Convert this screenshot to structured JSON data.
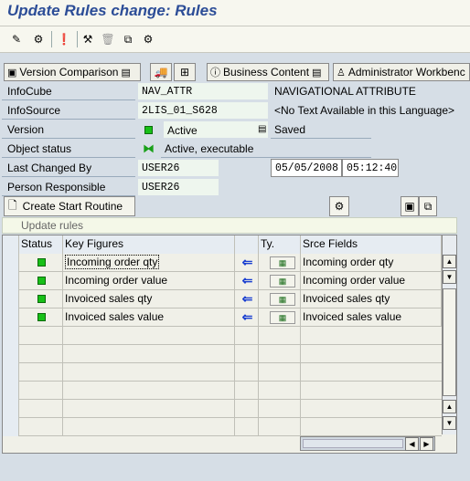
{
  "title": "Update Rules change: Rules",
  "toolbar_icons": [
    "edit-icon",
    "activate-icon",
    "check-icon",
    "transport-icon",
    "delete-icon",
    "copy-icon",
    "settings-icon"
  ],
  "func_toolbar": {
    "version_comparison": "Version Comparison",
    "business_content": "Business Content",
    "admin_workbench": "Administrator Workbenc"
  },
  "fields": {
    "infocube_label": "InfoCube",
    "infocube_value": "NAV_ATTR",
    "infocube_desc": "NAVIGATIONAL ATTRIBUTE",
    "infosource_label": "InfoSource",
    "infosource_value": "2LIS_01_S628",
    "infosource_desc": "<No Text Available in this Language>",
    "version_label": "Version",
    "version_value": "Active",
    "version_saved": "Saved",
    "object_status_label": "Object status",
    "object_status_value": "Active, executable",
    "last_changed_label": "Last Changed By",
    "last_changed_value": "USER26",
    "last_changed_date": "05/05/2008",
    "last_changed_time": "05:12:40",
    "person_resp_label": "Person Responsible",
    "person_resp_value": "USER26"
  },
  "create_start_routine": "Create Start Routine",
  "group_title": "Update rules",
  "table": {
    "headers": {
      "status": "Status",
      "key_figures": "Key Figures",
      "ty": "Ty.",
      "srce_fields": "Srce Fields"
    },
    "rows": [
      {
        "key_figure": "Incoming order qty",
        "source_field": "Incoming order qty"
      },
      {
        "key_figure": "Incoming order value",
        "source_field": "Incoming order value"
      },
      {
        "key_figure": "Invoiced sales qty",
        "source_field": "Invoiced sales qty"
      },
      {
        "key_figure": "Invoiced sales value",
        "source_field": "Invoiced sales value"
      }
    ]
  },
  "colors": {
    "title": "#2c4d97",
    "status_green": "#18c018",
    "arrow_blue": "#1a3fd0"
  }
}
